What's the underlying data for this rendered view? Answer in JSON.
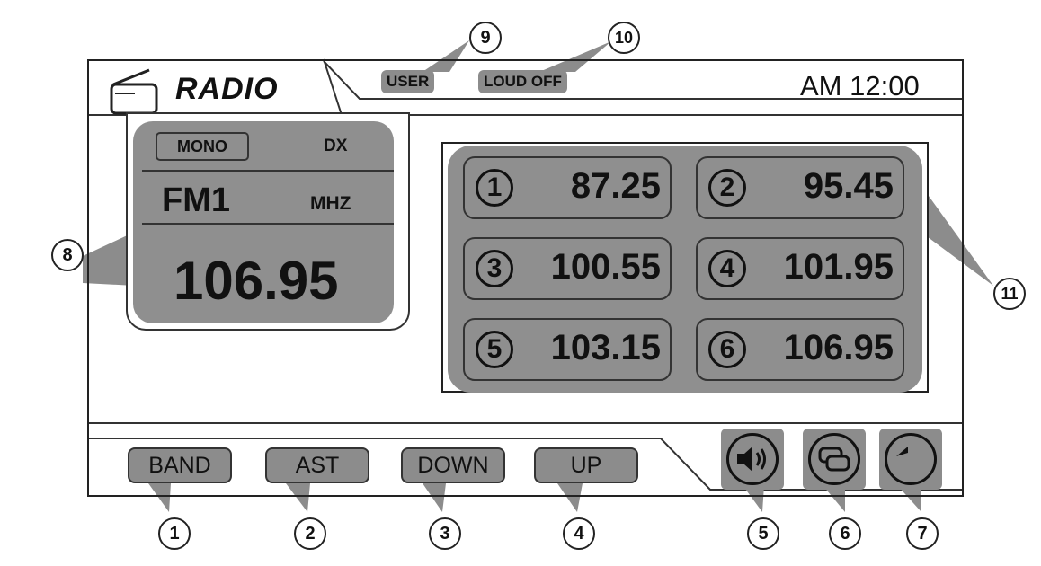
{
  "header": {
    "title": "RADIO",
    "user_badge": "USER",
    "loud_badge": "LOUD OFF",
    "clock": "AM 12:00"
  },
  "info": {
    "mono": "MONO",
    "dx": "DX",
    "band": "FM1",
    "unit": "MHZ",
    "frequency": "106.95"
  },
  "presets": [
    {
      "num": "1",
      "freq": "87.25"
    },
    {
      "num": "2",
      "freq": "95.45"
    },
    {
      "num": "3",
      "freq": "100.55"
    },
    {
      "num": "4",
      "freq": "101.95"
    },
    {
      "num": "5",
      "freq": "103.15"
    },
    {
      "num": "6",
      "freq": "106.95"
    }
  ],
  "buttons": {
    "band": "BAND",
    "ast": "AST",
    "down": "DOWN",
    "up": "UP"
  },
  "icons": {
    "volume": "speaker-icon",
    "mode": "switch-mode-icon",
    "back": "back-arrow-icon"
  },
  "callouts": [
    "1",
    "2",
    "3",
    "4",
    "5",
    "6",
    "7",
    "8",
    "9",
    "10",
    "11"
  ],
  "colors": {
    "panel_gray": "#8f8f8f",
    "outline": "#222222",
    "background": "#ffffff"
  }
}
